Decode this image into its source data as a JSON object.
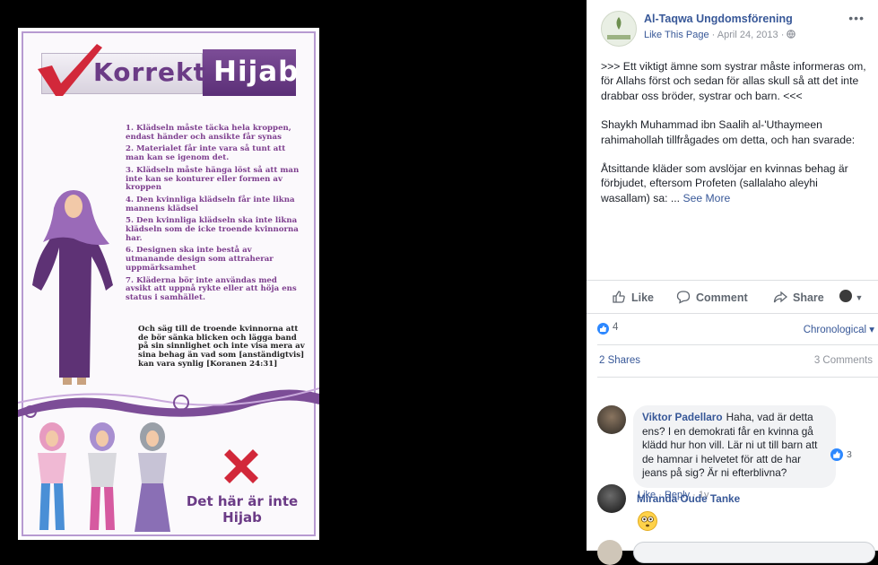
{
  "image": {
    "title_left": "Korrekt",
    "title_right": "Hijab",
    "rules": [
      "1. Klädseln måste täcka hela kroppen, endast händer och ansikte får synas",
      "2. Materialet får inte vara så tunt att man kan se igenom det.",
      "3. Klädseln måste hänga löst så att man inte kan se konturer eller formen av kroppen",
      "4. Den kvinnliga klädseln får inte likna mannens klädsel",
      "5. Den kvinnliga klädseln ska inte likna klädseln som de icke troende kvinnorna har.",
      "6. Designen ska inte bestå av utmanande design som attraherar uppmärksamhet",
      "7. Kläderna bör inte användas med avsikt att uppnå rykte eller att höja ens status i samhället."
    ],
    "quote": "Och säg till de troende kvinnorna att de bör sänka blicken och lägga band på sin sinnlighet och inte visa mera av sina behag än vad som [anständigtvis] kan vara synlig [Koranen 24:31]",
    "not_hijab": "Det här är inte Hijab",
    "colors": {
      "purple": "#6b3b86",
      "check_red": "#d2283a",
      "cross_red": "#d2283a"
    }
  },
  "post": {
    "page_name": "Al-Taqwa Ungdomsförening",
    "like_page": "Like This Page",
    "date": "April 24, 2013",
    "privacy_icon": "globe-icon",
    "paragraphs": [
      ">>> Ett viktigt ämne som systrar måste informeras om, för Allahs först och sedan för allas skull så att det inte drabbar oss bröder, systrar och barn. <<<",
      "Shaykh Muhammad ibn Saalih al-'Uthaymeen rahimahollah tillfrågades om detta, och han svarade:",
      "Åtsittande kläder som avslöjar en kvinnas behag är förbjudet, eftersom Profeten (sallalaho aleyhi wasallam) sa: ..."
    ],
    "see_more": "See More",
    "actions": {
      "like": "Like",
      "comment": "Comment",
      "share": "Share"
    },
    "reactions_count": "4",
    "sort": "Chronological ▾",
    "shares": "2 Shares",
    "comments_count": "3 Comments",
    "accent": "#385898"
  },
  "comments": [
    {
      "name": "Viktor Padellaro",
      "text": "Haha, vad är detta ens? I en demokrati får en kvinna gå klädd hur hon vill. Lär ni ut till barn att de hamnar i helvetet för att de har jeans på sig? Är ni efterblivna?",
      "like": "Like",
      "reply": "Reply",
      "age": "1y",
      "reactions": "3"
    },
    {
      "name": "Miranda Oude Tanke",
      "text": ""
    }
  ]
}
